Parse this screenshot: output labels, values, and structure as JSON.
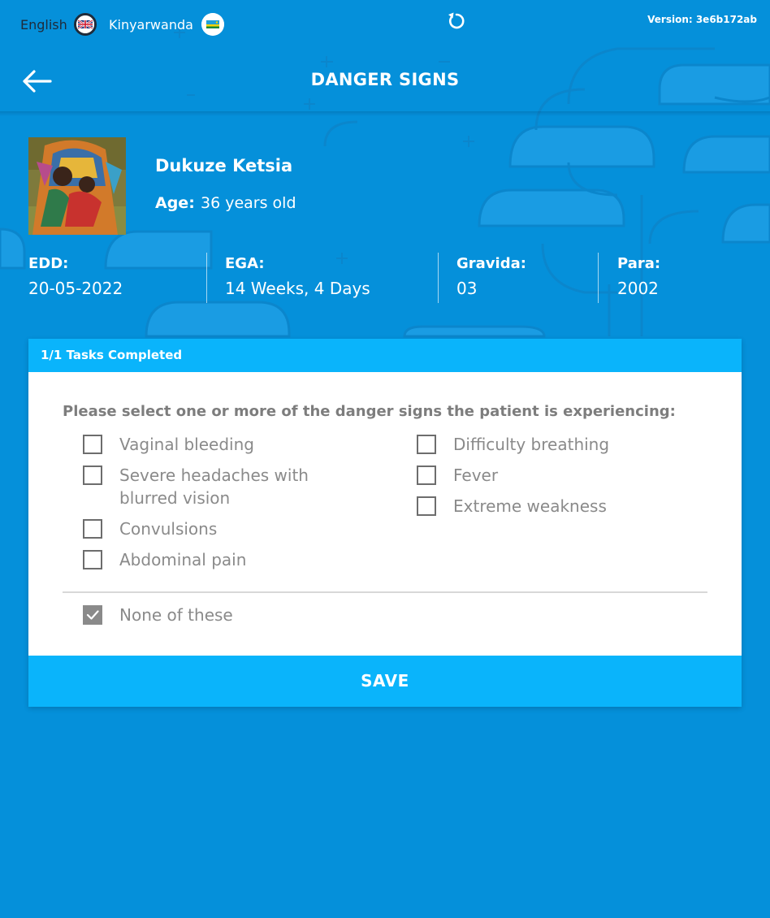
{
  "topbar": {
    "lang_en": "English",
    "lang_rw": "Kinyarwanda",
    "version": "Version: 3e6b172ab"
  },
  "header": {
    "title": "DANGER SIGNS"
  },
  "patient": {
    "name": "Dukuze Ketsia",
    "age_label": "Age:",
    "age_value": "36 years old",
    "stats": [
      {
        "label": "EDD:",
        "value": "20-05-2022"
      },
      {
        "label": "EGA:",
        "value": "14 Weeks, 4 Days"
      },
      {
        "label": "Gravida:",
        "value": "03"
      },
      {
        "label": "Para:",
        "value": "2002"
      }
    ]
  },
  "card": {
    "tasks_completed": "1/1 Tasks Completed",
    "question": "Please select one or more of the danger signs the patient is experiencing:",
    "options_left": [
      {
        "label": "Vaginal bleeding",
        "checked": false
      },
      {
        "label": "Severe headaches with blurred vision",
        "checked": false
      },
      {
        "label": "Convulsions",
        "checked": false
      },
      {
        "label": "Abdominal pain",
        "checked": false
      }
    ],
    "options_right": [
      {
        "label": "Difficulty breathing",
        "checked": false
      },
      {
        "label": "Fever",
        "checked": false
      },
      {
        "label": "Extreme weakness",
        "checked": false
      }
    ],
    "none_option": {
      "label": "None of these",
      "checked": true
    },
    "save_label": "SAVE"
  },
  "colors": {
    "background": "#0590da",
    "accent": "#0ab4fb",
    "checkbox_checked": "#8a8a8a"
  },
  "icons": {
    "back": "arrow-left-icon",
    "refresh": "refresh-icon",
    "flag_uk": "uk-flag-icon",
    "flag_rw": "rwanda-flag-icon"
  }
}
